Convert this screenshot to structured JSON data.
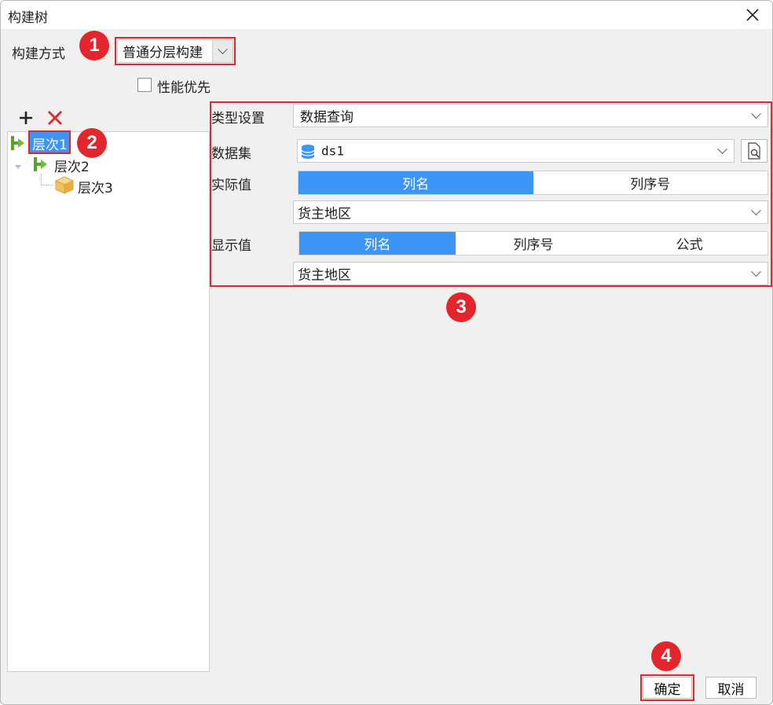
{
  "window": {
    "title": "构建树"
  },
  "build": {
    "label": "构建方式",
    "method_value": "普通分层构建",
    "perf_label": "性能优先",
    "perf_checked": false
  },
  "toolbar": {
    "add_icon": "plus-icon",
    "delete_icon": "red-x-icon"
  },
  "tree": {
    "items": [
      {
        "label": "层次1",
        "icon": "green-branch-icon",
        "selected": true
      },
      {
        "label": "层次2",
        "icon": "green-branch-icon",
        "selected": false
      },
      {
        "label": "层次3",
        "icon": "yellow-box-icon",
        "selected": false
      }
    ]
  },
  "settings": {
    "type_label": "类型设置",
    "type_value": "数据查询",
    "dataset_label": "数据集",
    "dataset_value": "ds1",
    "actual_label": "实际值",
    "actual_options": [
      "列名",
      "列序号"
    ],
    "actual_selected": "列名",
    "actual_field": "货主地区",
    "display_label": "显示值",
    "display_options": [
      "列名",
      "列序号",
      "公式"
    ],
    "display_selected": "列名",
    "display_field": "货主地区"
  },
  "badges": [
    "1",
    "2",
    "3",
    "4"
  ],
  "footer": {
    "ok_label": "确定",
    "cancel_label": "取消"
  },
  "colors": {
    "annotation_red": "#e3262c",
    "selected_blue": "#3d95f5"
  }
}
